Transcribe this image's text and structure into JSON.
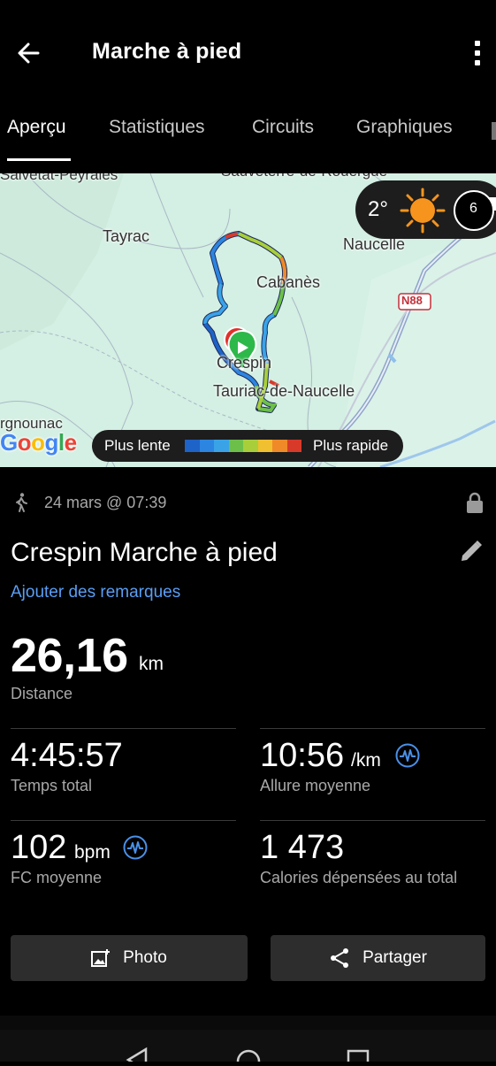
{
  "header": {
    "title": "Marche à pied",
    "back_icon": "arrow-left-icon",
    "menu_icon": "more-vertical-icon"
  },
  "tabs": [
    {
      "label": "Aperçu",
      "active": true
    },
    {
      "label": "Statistiques",
      "active": false
    },
    {
      "label": "Circuits",
      "active": false
    },
    {
      "label": "Graphiques",
      "active": false
    }
  ],
  "map": {
    "places": {
      "salvetat": "Salvetat-Peyralès",
      "sauveterre": "Sauveterre-de-Rouergue",
      "tayrac": "Tayrac",
      "naucelle": "Naucelle",
      "cabanes": "Cabanès",
      "crespin": "Crespin",
      "tauriac": "Tauriac-de-Naucelle",
      "gnounac": "rgnounac",
      "road": "N88"
    },
    "brand": "Google",
    "weather": {
      "temperature": "2°",
      "weather_icon": "sun-icon",
      "moon_icon": "moon-phase-icon",
      "moon_value": "6"
    },
    "legend": {
      "slow_label": "Plus lente",
      "fast_label": "Plus rapide",
      "colors": [
        "#1e63c8",
        "#2c85e0",
        "#3aa3e8",
        "#6cc04a",
        "#a8cf3a",
        "#f0c030",
        "#f08a28",
        "#d83a2a"
      ]
    }
  },
  "activity": {
    "activity_icon": "walking-icon",
    "date": "24 mars @ 07:39",
    "privacy_icon": "lock-icon",
    "title": "Crespin Marche à pied",
    "edit_icon": "pencil-icon",
    "notes_link": "Ajouter des remarques"
  },
  "stats": {
    "distance": {
      "value": "26,16",
      "unit": "km",
      "label": "Distance"
    },
    "total_time": {
      "value": "4:45:57",
      "label": "Temps total"
    },
    "avg_pace": {
      "value": "10:56",
      "unit": "/km",
      "label": "Allure moyenne"
    },
    "avg_hr": {
      "value": "102",
      "unit": "bpm",
      "label": "FC moyenne"
    },
    "calories": {
      "value": "1 473",
      "label": "Calories dépensées au total"
    }
  },
  "actions": {
    "photo_label": "Photo",
    "share_label": "Partager"
  },
  "colors": {
    "background": "#000000",
    "accent_link": "#5a9ef5",
    "button_bg": "#2d2d2d",
    "start_marker": "#2db84a",
    "end_marker": "#e0312b"
  }
}
